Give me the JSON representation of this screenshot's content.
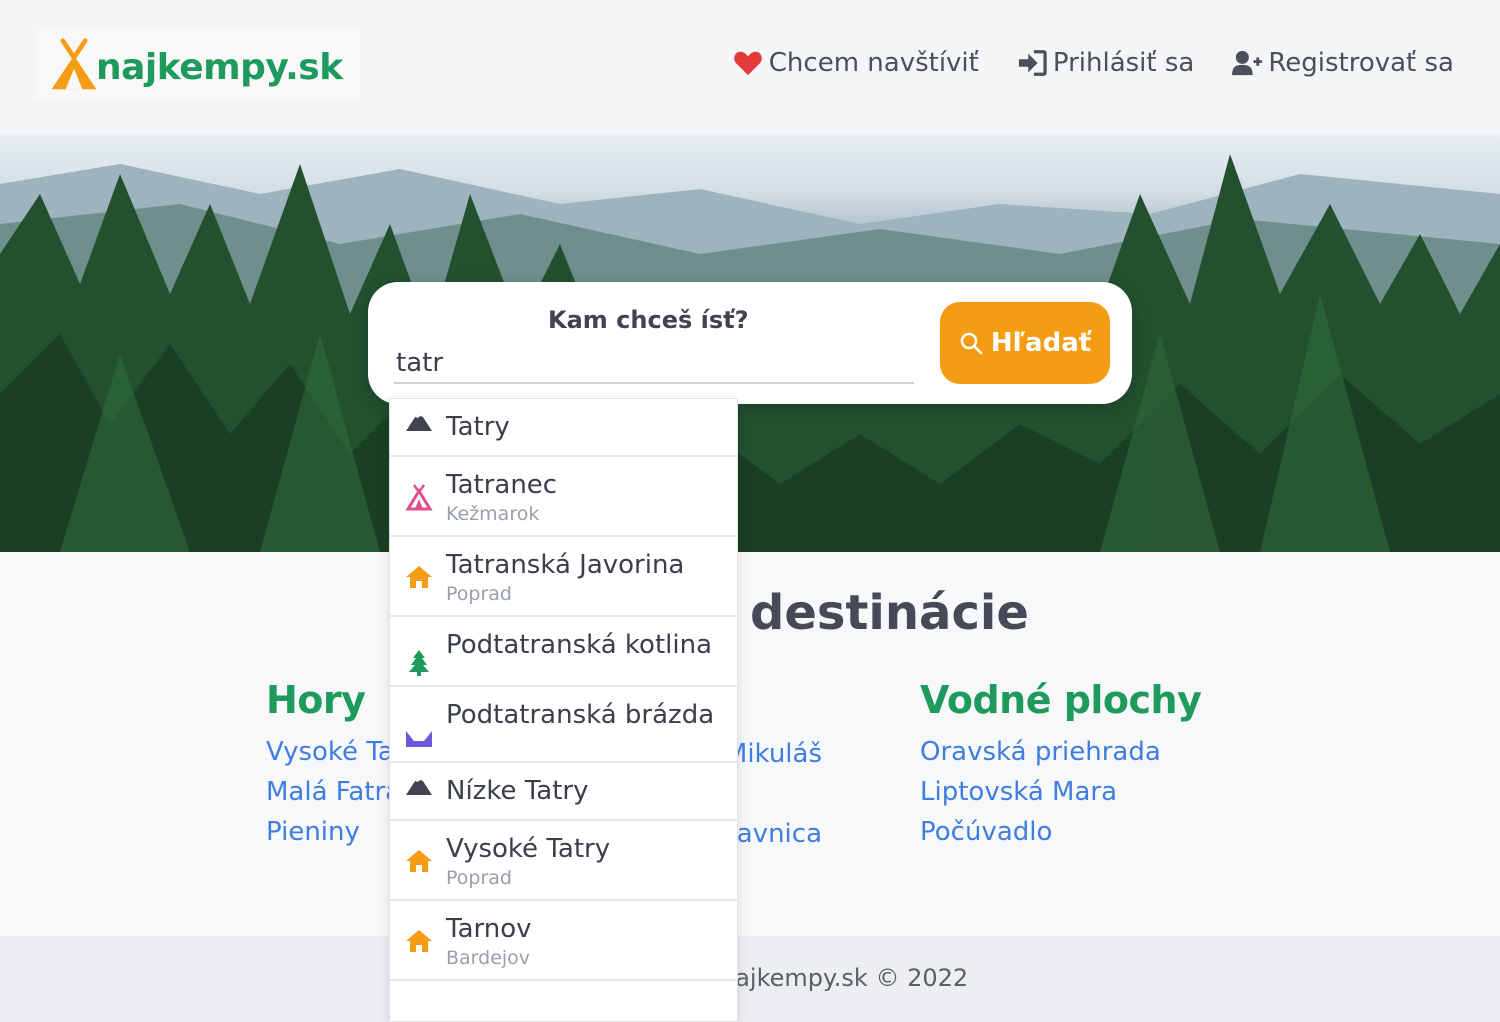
{
  "header": {
    "logo_text": "najkempy.sk",
    "nav": [
      {
        "label": "Chcem navštíviť",
        "icon": "heart-icon"
      },
      {
        "label": "Prihlásiť sa",
        "icon": "sign-in-icon"
      },
      {
        "label": "Registrovať sa",
        "icon": "user-plus-icon"
      }
    ]
  },
  "search": {
    "label": "Kam chceš ísť?",
    "value": "tatr",
    "button_label": "Hľadať"
  },
  "dropdown": {
    "items": [
      {
        "name": "Tatry",
        "sub": "",
        "icon": "mountain-icon"
      },
      {
        "name": "Tatranec",
        "sub": "Kežmarok",
        "icon": "tent-icon"
      },
      {
        "name": "Tatranská Javorina",
        "sub": "Poprad",
        "icon": "house-icon"
      },
      {
        "name": "Podtatranská kotlina",
        "sub": "",
        "icon": "tree-icon"
      },
      {
        "name": "Podtatranská brázda",
        "sub": "",
        "icon": "valley-icon"
      },
      {
        "name": "Nízke Tatry",
        "sub": "",
        "icon": "mountain-icon"
      },
      {
        "name": "Vysoké Tatry",
        "sub": "Poprad",
        "icon": "house-icon"
      },
      {
        "name": "Tarnov",
        "sub": "Bardejov",
        "icon": "house-icon"
      }
    ]
  },
  "main": {
    "title_visible": "destinácie",
    "hory": {
      "heading": "Hory",
      "links": [
        "Vysoké Tatry",
        "Malá Fatra",
        "Pieniny"
      ]
    },
    "middle": {
      "links": [
        "Liptovský Mikuláš",
        "",
        "Banská Štiavnica"
      ]
    },
    "vodne": {
      "heading": "Vodné plochy",
      "links": [
        "Oravská priehrada",
        "Liptovská Mara",
        "Počúvadlo"
      ]
    }
  },
  "footer": {
    "text": "najkempy.sk © 2022"
  },
  "colors": {
    "accent": "#f49c14",
    "brand_green": "#1d9a5c",
    "link_blue": "#3f7de0"
  }
}
